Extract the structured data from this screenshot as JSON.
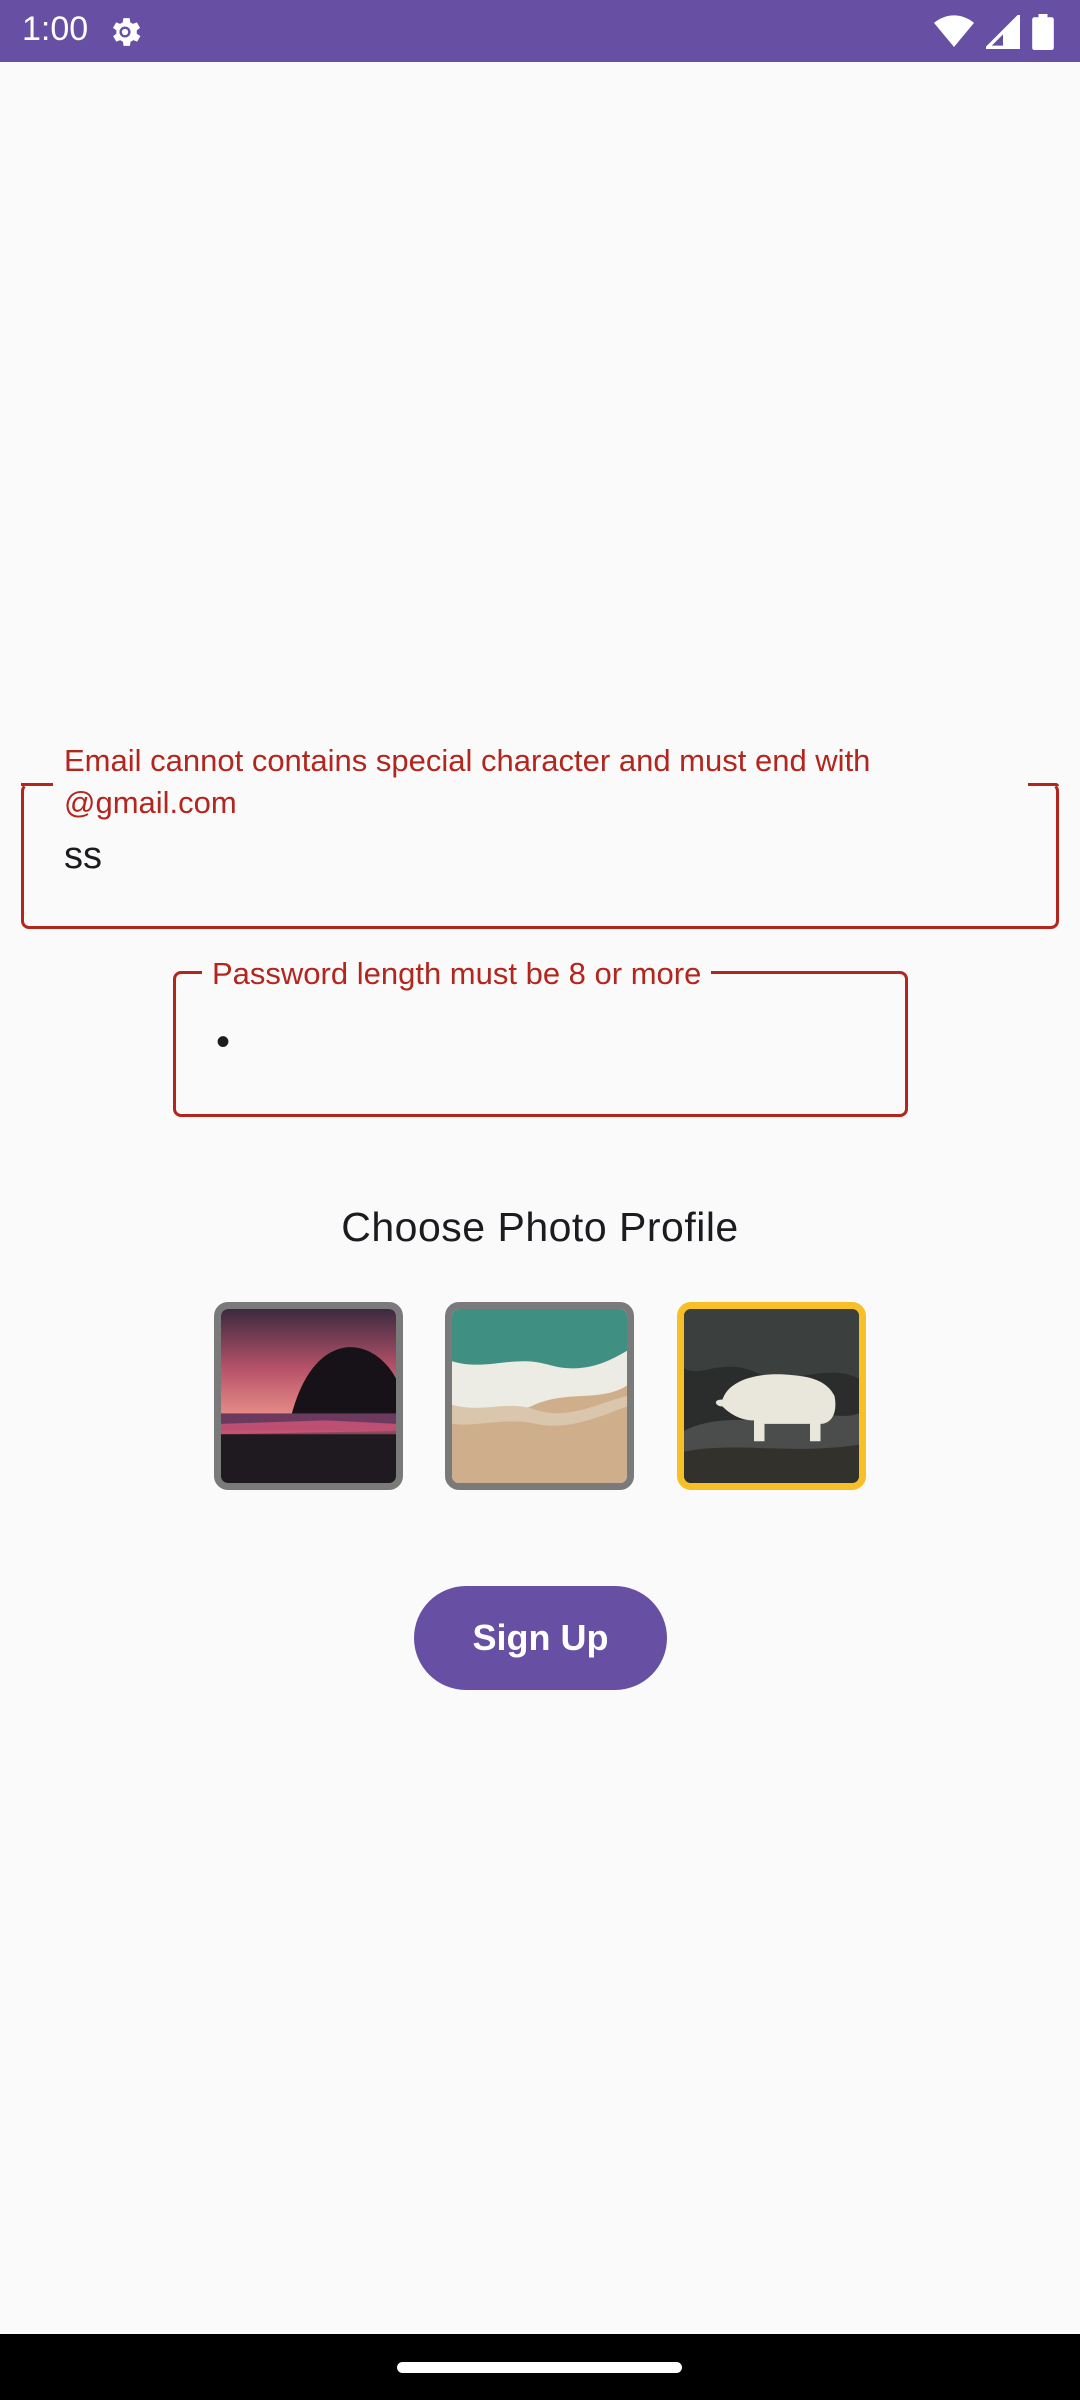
{
  "status_bar": {
    "time": "1:00",
    "icons": [
      "settings-gear-icon",
      "wifi-icon",
      "cell-signal-icon",
      "battery-icon"
    ]
  },
  "email": {
    "error_label": "Email cannot contains special character and must end with @gmail.com",
    "value": "ss"
  },
  "password": {
    "error_label": "Password length must be 8 or more",
    "value": "•"
  },
  "photo_section": {
    "heading": "Choose Photo Profile",
    "photos": [
      {
        "name": "sunset-beach-photo",
        "selected": false
      },
      {
        "name": "ocean-shore-photo",
        "selected": false
      },
      {
        "name": "polar-bear-photo",
        "selected": true
      }
    ]
  },
  "signup": {
    "label": "Sign Up"
  },
  "colors": {
    "primary": "#6750a4",
    "error": "#b3261e",
    "selected_border": "#f6c026",
    "unselected_border": "#7a7a7a"
  }
}
